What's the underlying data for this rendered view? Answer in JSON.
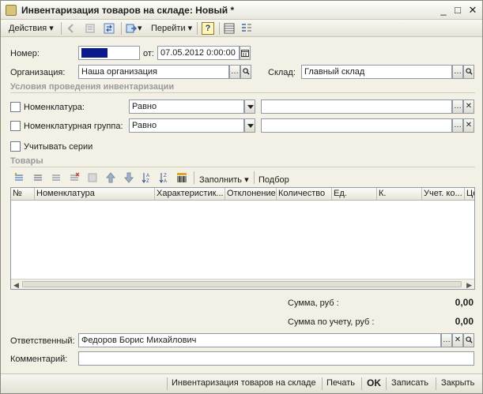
{
  "window": {
    "title": "Инвентаризация товаров на складе: Новый *",
    "controls": {
      "minimize": "_",
      "maximize": "□",
      "close": "✕"
    }
  },
  "toolbar": {
    "actions_label": "Действия",
    "goto_label": "Перейти",
    "help_label": "?"
  },
  "form": {
    "number_label": "Номер:",
    "number_value": "",
    "date_label": "от:",
    "date_value": "07.05.2012  0:00:00",
    "org_label": "Организация:",
    "org_value": "Наша организация",
    "warehouse_label": "Склад:",
    "warehouse_value": "Главный склад",
    "conditions_title": "Условия проведения инвентаризации",
    "nomenclature_label": "Номенклатура:",
    "nomenclature_condition": "Равно",
    "nomenclature_value": "",
    "group_label": "Номенклатурная группа:",
    "group_condition": "Равно",
    "group_value": "",
    "series_label": "Учитывать серии",
    "goods_title": "Товары",
    "fill_label": "Заполнить",
    "select_label": "Подбор"
  },
  "table": {
    "columns": [
      "№",
      "Номенклатура",
      "Характеристик...",
      "Отклонение",
      "Количество",
      "Ед.",
      "К.",
      "Учет. ко...",
      "Це"
    ]
  },
  "totals": {
    "sum_label": "Сумма, руб :",
    "sum_value": "0,00",
    "sum_acc_label": "Сумма по учету, руб :",
    "sum_acc_value": "0,00"
  },
  "bottom": {
    "responsible_label": "Ответственный:",
    "responsible_value": "Федоров Борис Михайлович",
    "comment_label": "Комментарий:",
    "comment_value": ""
  },
  "footer": {
    "print_form_label": "Инвентаризация товаров на складе",
    "print_label": "Печать",
    "ok_label": "OK",
    "save_label": "Записать",
    "close_label": "Закрыть"
  },
  "colors": {
    "number_fill": "#0a1a8c",
    "window_bg": "#f3f1e6",
    "section_title": "#9a9a9a"
  }
}
